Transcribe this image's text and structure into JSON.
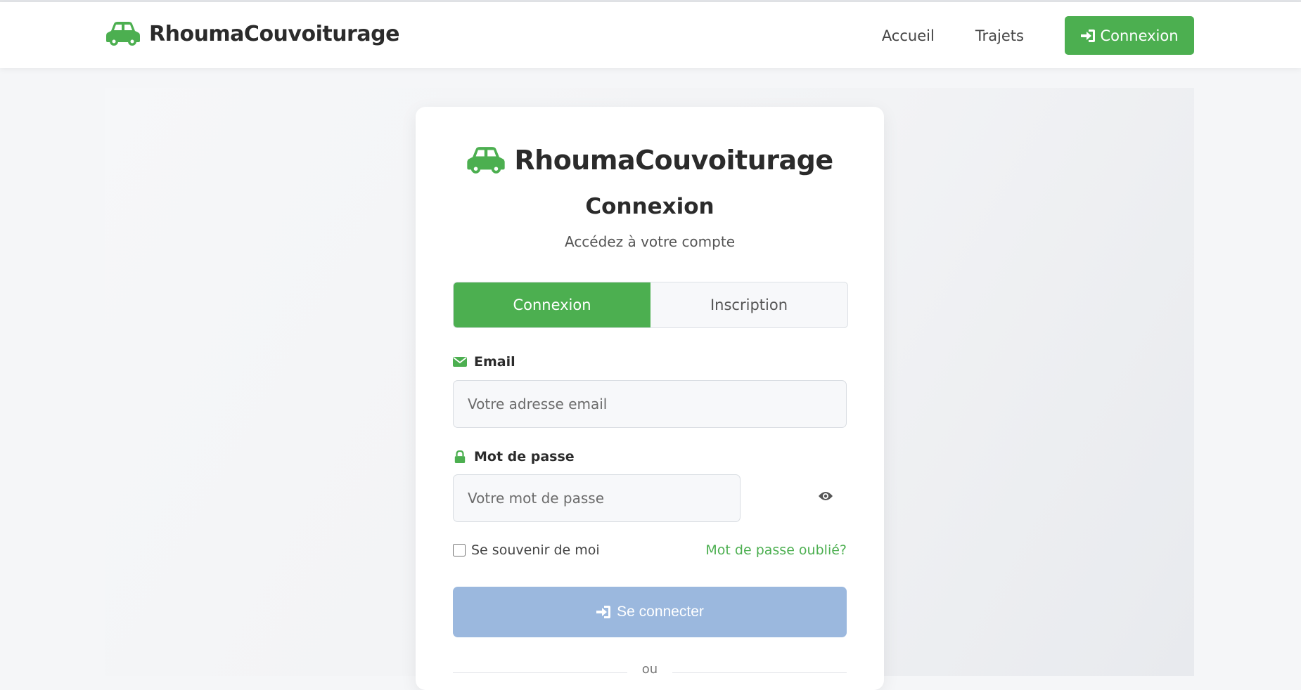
{
  "header": {
    "brand": "RhoumaCouvoiturage",
    "nav": {
      "home": "Accueil",
      "trips": "Trajets",
      "login": "Connexion"
    }
  },
  "card": {
    "brand": "RhoumaCouvoiturage",
    "title": "Connexion",
    "subtitle": "Accédez à votre compte",
    "tabs": {
      "login": "Connexion",
      "register": "Inscription",
      "active": "login"
    },
    "email": {
      "label": "Email",
      "placeholder": "Votre adresse email",
      "value": ""
    },
    "password": {
      "label": "Mot de passe",
      "placeholder": "Votre mot de passe",
      "value": ""
    },
    "remember": {
      "label": "Se souvenir de moi",
      "checked": false
    },
    "forgot": "Mot de passe oublié?",
    "submit": "Se connecter",
    "separator": "ou"
  },
  "icons": {
    "brand": "car-icon",
    "login": "sign-in-icon",
    "email": "envelope-icon",
    "password": "lock-icon",
    "toggle_password": "eye-icon"
  },
  "colors": {
    "accent": "#4caf50",
    "submit_disabled": "#9bb8de",
    "text": "#2b2b2b"
  }
}
